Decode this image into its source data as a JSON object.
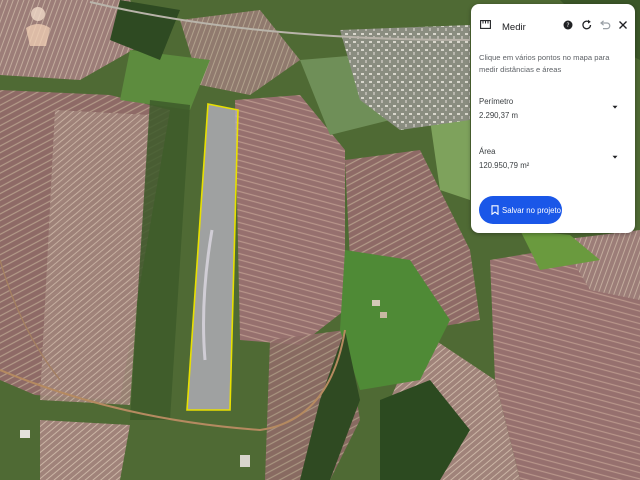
{
  "panel": {
    "title": "Medir",
    "icon": "ruler-icon",
    "header_buttons": [
      "help-icon",
      "undo-icon",
      "redo-icon",
      "close-icon"
    ],
    "description": "Clique em vários pontos no mapa para medir distâncias e áreas",
    "perimeter": {
      "label": "Perímetro",
      "value": "2.290,37 m"
    },
    "area": {
      "label": "Área",
      "value": "120.950,79 m²"
    },
    "save_button": {
      "label": "Salvar no projeto",
      "icon": "bookmark-icon",
      "color": "#1a57e8"
    }
  },
  "map": {
    "measured_outline_color": "#e8e000",
    "view": "satellite"
  }
}
